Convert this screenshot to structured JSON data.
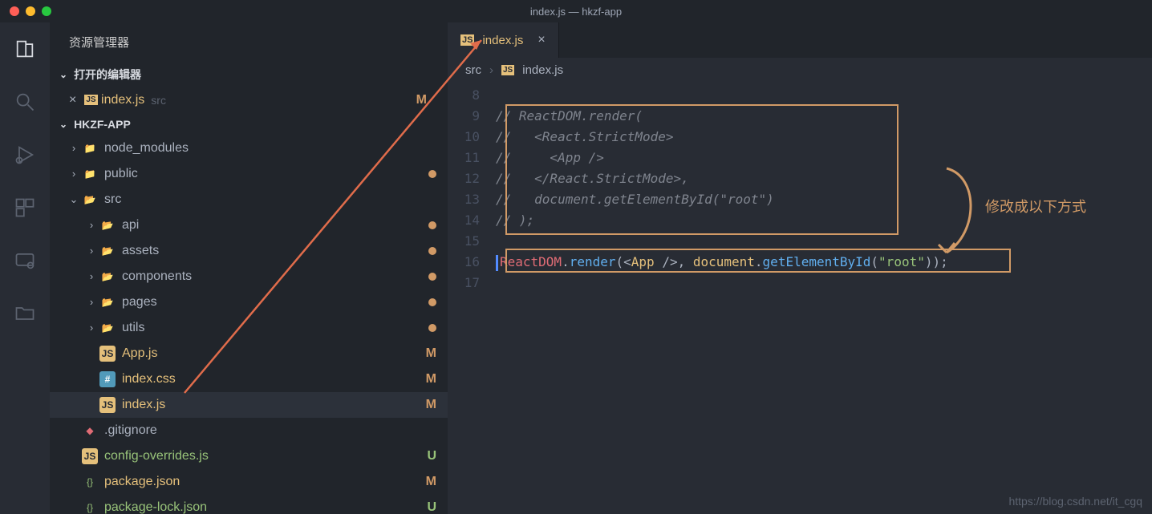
{
  "title": "index.js — hkzf-app",
  "sidebar_title": "资源管理器",
  "open_editors_label": "打开的编辑器",
  "project_label": "HKZF-APP",
  "open_editor": {
    "name": "index.js",
    "path": "src",
    "status": "M"
  },
  "tree": [
    {
      "depth": 0,
      "kind": "folder",
      "name": "node_modules",
      "expanded": false,
      "hasArrow": true,
      "statusDot": false
    },
    {
      "depth": 0,
      "kind": "folder",
      "name": "public",
      "expanded": false,
      "hasArrow": true,
      "statusDot": true
    },
    {
      "depth": 0,
      "kind": "folder-green",
      "name": "src",
      "expanded": true,
      "hasArrow": true,
      "statusDot": false
    },
    {
      "depth": 1,
      "kind": "folder-green",
      "name": "api",
      "expanded": false,
      "hasArrow": true,
      "statusDot": true
    },
    {
      "depth": 1,
      "kind": "folder-green",
      "name": "assets",
      "expanded": false,
      "hasArrow": true,
      "statusDot": true
    },
    {
      "depth": 1,
      "kind": "folder-green",
      "name": "components",
      "expanded": false,
      "hasArrow": true,
      "statusDot": true
    },
    {
      "depth": 1,
      "kind": "folder-green",
      "name": "pages",
      "expanded": false,
      "hasArrow": true,
      "statusDot": true
    },
    {
      "depth": 1,
      "kind": "folder-green",
      "name": "utils",
      "expanded": false,
      "hasArrow": true,
      "statusDot": true
    },
    {
      "depth": 1,
      "kind": "js",
      "name": "App.js",
      "status": "M"
    },
    {
      "depth": 1,
      "kind": "css",
      "name": "index.css",
      "status": "M"
    },
    {
      "depth": 1,
      "kind": "js",
      "name": "index.js",
      "status": "M",
      "selected": true
    },
    {
      "depth": 0,
      "kind": "git",
      "name": ".gitignore"
    },
    {
      "depth": 0,
      "kind": "js",
      "name": "config-overrides.js",
      "status": "U"
    },
    {
      "depth": 0,
      "kind": "json",
      "name": "package.json",
      "status": "M"
    },
    {
      "depth": 0,
      "kind": "json",
      "name": "package-lock.json",
      "status": "U"
    }
  ],
  "tab": {
    "name": "index.js"
  },
  "breadcrumb": {
    "folder": "src",
    "file": "index.js"
  },
  "code_lines": [
    {
      "n": 8,
      "html": ""
    },
    {
      "n": 9,
      "html": "<span class='comment'>// ReactDOM.render(</span>"
    },
    {
      "n": 10,
      "html": "<span class='comment'>//   &lt;React.StrictMode&gt;</span>"
    },
    {
      "n": 11,
      "html": "<span class='comment'>//     &lt;App /&gt;</span>"
    },
    {
      "n": 12,
      "html": "<span class='comment'>//   &lt;/React.StrictMode&gt;,</span>"
    },
    {
      "n": 13,
      "html": "<span class='comment'>//   document.getElementById(\"root\")</span>"
    },
    {
      "n": 14,
      "html": "<span class='comment'>// );</span>"
    },
    {
      "n": 15,
      "html": ""
    },
    {
      "n": 16,
      "html": "<span class='cursor-bar'></span><span class='kw-obj'>ReactDOM</span><span class='kw-punc'>.</span><span class='kw-func'>render</span><span class='kw-punc'>(&lt;</span><span class='kw-tag'>App</span> <span class='kw-punc'>/&gt;, </span><span class='kw-doc'>document</span><span class='kw-punc'>.</span><span class='kw-func'>getElementById</span><span class='kw-punc'>(</span><span class='kw-str'>\"root\"</span><span class='kw-punc'>));</span>"
    },
    {
      "n": 17,
      "html": ""
    }
  ],
  "annotation_text": "修改成以下方式",
  "watermark": "https://blog.csdn.net/it_cgq"
}
